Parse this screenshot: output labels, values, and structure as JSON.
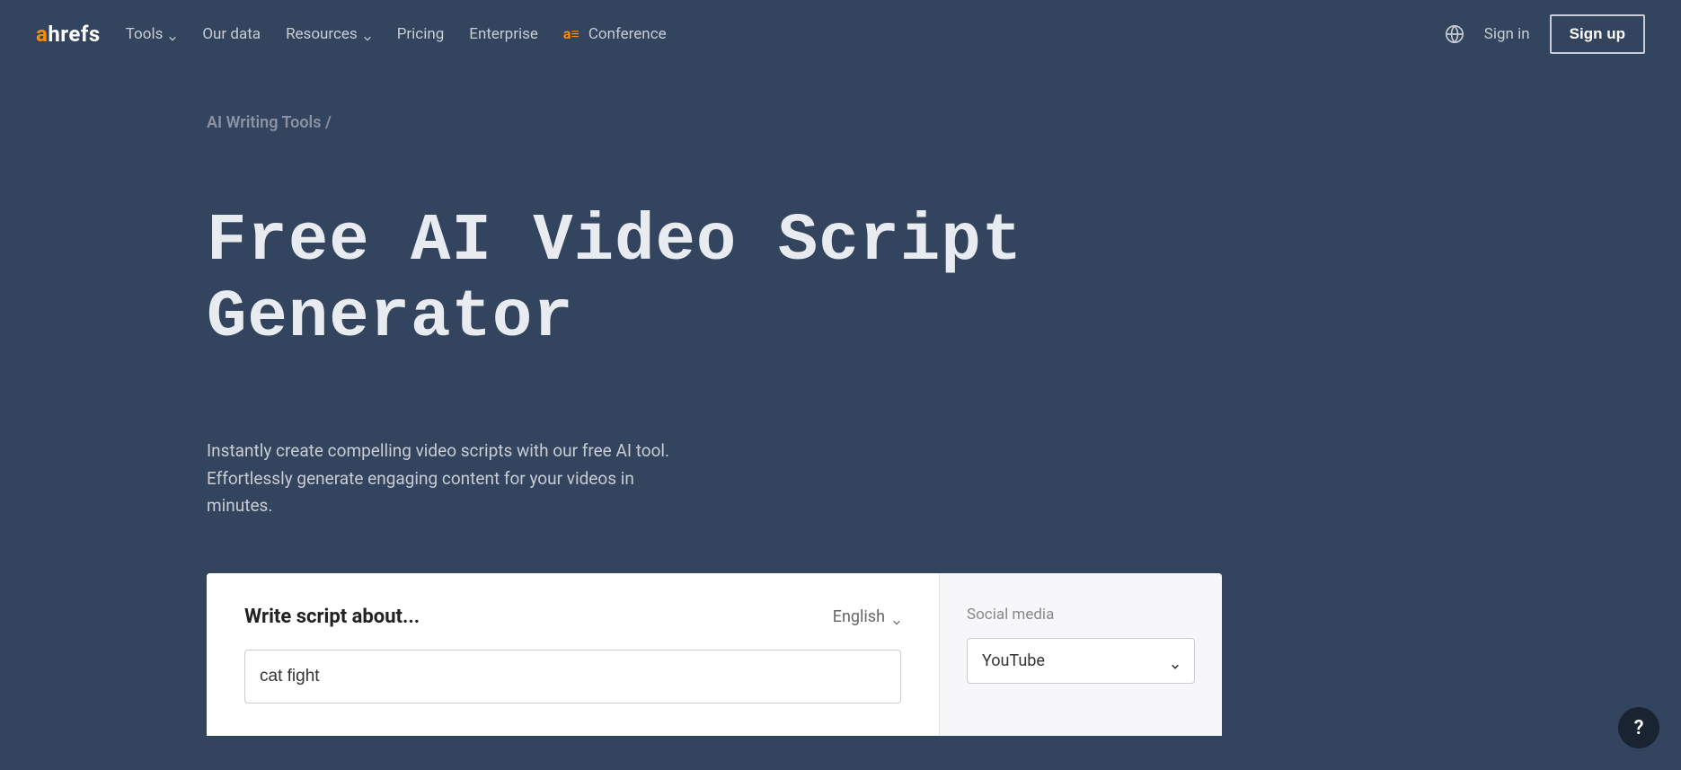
{
  "header": {
    "logo_a": "a",
    "logo_rest": "hrefs",
    "nav": {
      "tools": "Tools",
      "our_data": "Our data",
      "resources": "Resources",
      "pricing": "Pricing",
      "enterprise": "Enterprise",
      "conference": "Conference"
    },
    "sign_in": "Sign in",
    "sign_up": "Sign up"
  },
  "breadcrumb": "AI Writing Tools /",
  "hero": {
    "title": "Free AI Video Script Generator",
    "subtitle": "Instantly create compelling video scripts with our free AI tool. Effortlessly generate engaging content for your videos in minutes."
  },
  "form": {
    "label": "Write script about...",
    "language": "English",
    "input_value": "cat fight",
    "side_label": "Social media",
    "social_value": "YouTube"
  },
  "help": "?"
}
